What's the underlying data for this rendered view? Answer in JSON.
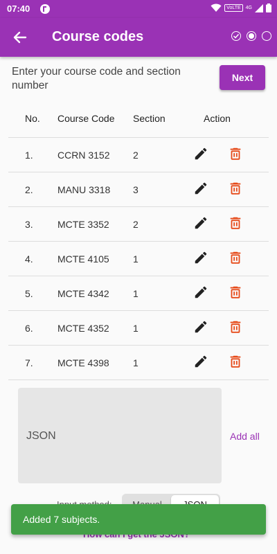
{
  "status_bar": {
    "time": "07:40",
    "network_badge": "VoLTE",
    "network_type": "4G"
  },
  "app_bar": {
    "title": "Course codes",
    "back_icon": "arrow-back-icon",
    "steps": [
      {
        "state": "done",
        "icon": "check-circle-icon"
      },
      {
        "state": "current",
        "icon": "radio-checked-icon"
      },
      {
        "state": "pending",
        "icon": "radio-unchecked-icon"
      }
    ]
  },
  "instruction": "Enter your course code and section number",
  "next_label": "Next",
  "table": {
    "headers": {
      "no": "No.",
      "code": "Course Code",
      "section": "Section",
      "action": "Action"
    },
    "rows": [
      {
        "no": "1.",
        "code": "CCRN 3152",
        "section": "2"
      },
      {
        "no": "2.",
        "code": "MANU 3318",
        "section": "3"
      },
      {
        "no": "3.",
        "code": "MCTE 3352",
        "section": "2"
      },
      {
        "no": "4.",
        "code": "MCTE 4105",
        "section": "1"
      },
      {
        "no": "5.",
        "code": "MCTE 4342",
        "section": "1"
      },
      {
        "no": "6.",
        "code": "MCTE 4352",
        "section": "1"
      },
      {
        "no": "7.",
        "code": "MCTE 4398",
        "section": "1"
      }
    ],
    "edit_icon": "pencil-icon",
    "delete_icon": "trash-icon"
  },
  "json_input": {
    "placeholder": "JSON"
  },
  "add_all_label": "Add all",
  "input_method": {
    "label": "Input method:",
    "options": [
      "Manual",
      "JSON"
    ],
    "selected": "JSON"
  },
  "help_link": "How can I get the JSON?",
  "snackbar": {
    "message": "Added 7 subjects."
  },
  "colors": {
    "primary": "#9a32b5",
    "delete": "#e64a19",
    "snackbar": "#43a047"
  }
}
